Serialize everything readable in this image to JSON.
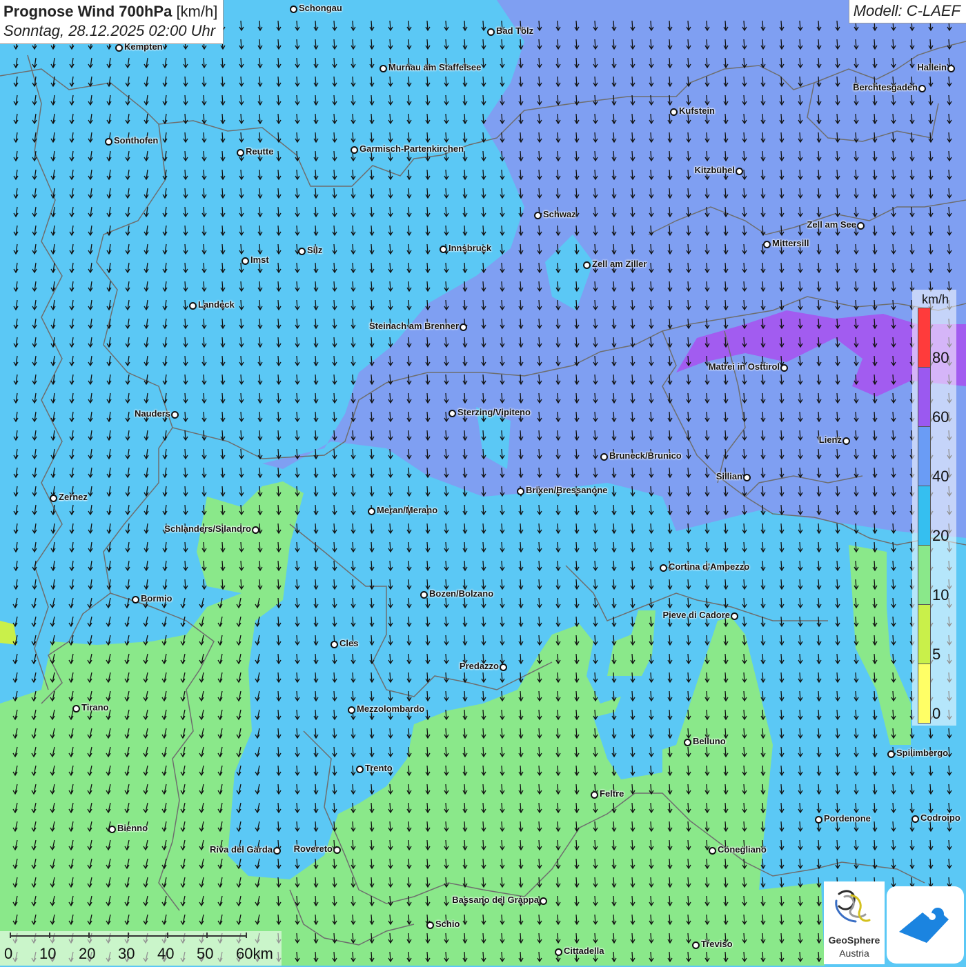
{
  "header": {
    "title_main": "Prognose Wind 700hPa",
    "title_unit": "[km/h]",
    "subtitle": "Sonntag, 28.12.2025 02:00 Uhr",
    "model": "Modell: C-LAEF"
  },
  "legend": {
    "unit": "km/h",
    "labels": [
      "80",
      "60",
      "40",
      "20",
      "10",
      "5",
      "0"
    ],
    "colors": [
      "#ff3b3b",
      "#9b59f0",
      "#6a9cf5",
      "#35bff0",
      "#8ae88a",
      "#c9f04a",
      "#ffff66"
    ]
  },
  "scale": {
    "labels": [
      "0",
      "10",
      "20",
      "30",
      "40",
      "50",
      "60km"
    ]
  },
  "logos": {
    "geosphere_line1": "GeoSphere",
    "geosphere_line2": "Austria",
    "app_icon": "cloud-wind-app-icon"
  },
  "cities": [
    {
      "name": "Schongau"
    },
    {
      "name": "Bad Tölz"
    },
    {
      "name": "Kempten"
    },
    {
      "name": "Murnau am Staffelsee"
    },
    {
      "name": "Hallein"
    },
    {
      "name": "Berchtesgaden"
    },
    {
      "name": "Kufstein"
    },
    {
      "name": "Sonthofen"
    },
    {
      "name": "Reutte"
    },
    {
      "name": "Garmisch-Partenkirchen"
    },
    {
      "name": "Kitzbühel"
    },
    {
      "name": "Schwaz"
    },
    {
      "name": "Zell am See"
    },
    {
      "name": "Innsbruck"
    },
    {
      "name": "Silz"
    },
    {
      "name": "Imst"
    },
    {
      "name": "Mittersill"
    },
    {
      "name": "Zell am Ziller"
    },
    {
      "name": "Landeck"
    },
    {
      "name": "Steinach am Brenner"
    },
    {
      "name": "Matrei in Osttirol"
    },
    {
      "name": "Nauders"
    },
    {
      "name": "Sterzing/Vipiteno"
    },
    {
      "name": "Lienz"
    },
    {
      "name": "Bruneck/Brunico"
    },
    {
      "name": "Sillian"
    },
    {
      "name": "Zernez"
    },
    {
      "name": "Brixen/Bressanone"
    },
    {
      "name": "Meran/Merano"
    },
    {
      "name": "Schlanders/Silandro"
    },
    {
      "name": "Cortina d'Ampezzo"
    },
    {
      "name": "Bozen/Bolzano"
    },
    {
      "name": "Bormio"
    },
    {
      "name": "Pieve di Cadore"
    },
    {
      "name": "Cles"
    },
    {
      "name": "Predazzo"
    },
    {
      "name": "Tirano"
    },
    {
      "name": "Mezzolombardo"
    },
    {
      "name": "Belluno"
    },
    {
      "name": "Spilimbergo"
    },
    {
      "name": "Trento"
    },
    {
      "name": "Feltre"
    },
    {
      "name": "Bienno"
    },
    {
      "name": "Pordenone"
    },
    {
      "name": "Codroipo"
    },
    {
      "name": "Riva del Garda"
    },
    {
      "name": "Rovereto"
    },
    {
      "name": "Conegliano"
    },
    {
      "name": "Bassano del Grappa"
    },
    {
      "name": "Schio"
    },
    {
      "name": "Treviso"
    },
    {
      "name": "Cittadella"
    }
  ]
}
